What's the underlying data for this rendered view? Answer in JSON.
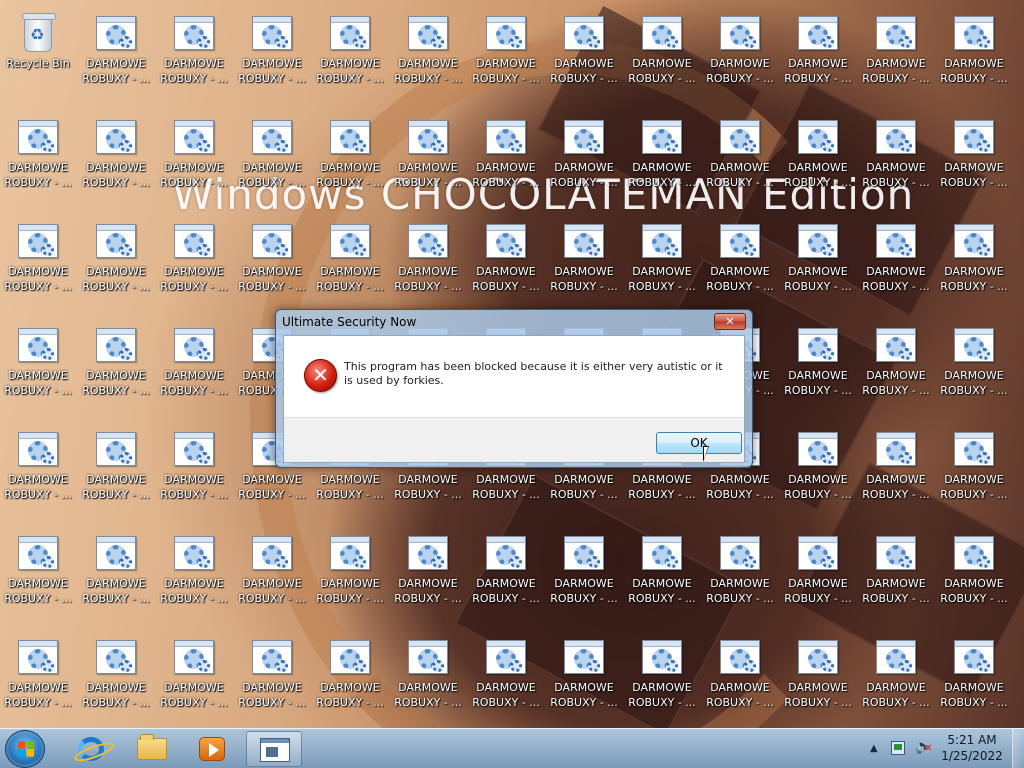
{
  "desktop": {
    "wallpaper_text": "Windows CHOCOLATEMAN Edition",
    "recycle_bin_label": "Recycle Bin",
    "icon_label_line1": "DARMOWE",
    "icon_label_line2": "ROBUXY - ...",
    "icon_type": "gear-program-icon"
  },
  "dialog": {
    "title": "Ultimate Security Now",
    "close_label": "✕",
    "icon": "error-icon",
    "message": "This program has been blocked because it is either very autistic or it is used by forkies.",
    "ok_label": "OK"
  },
  "taskbar": {
    "start": "windows-start-orb",
    "pinned": [
      "internet-explorer-icon",
      "file-explorer-icon",
      "media-player-icon",
      "app-window-icon"
    ],
    "tray": {
      "time": "5:21 AM",
      "date": "1/25/2022",
      "volume_state": "muted"
    }
  },
  "colors": {
    "error_red": "#d21f0f",
    "taskbar_blue": "#9ab8d6",
    "ok_button_border": "#3c7fb1"
  }
}
